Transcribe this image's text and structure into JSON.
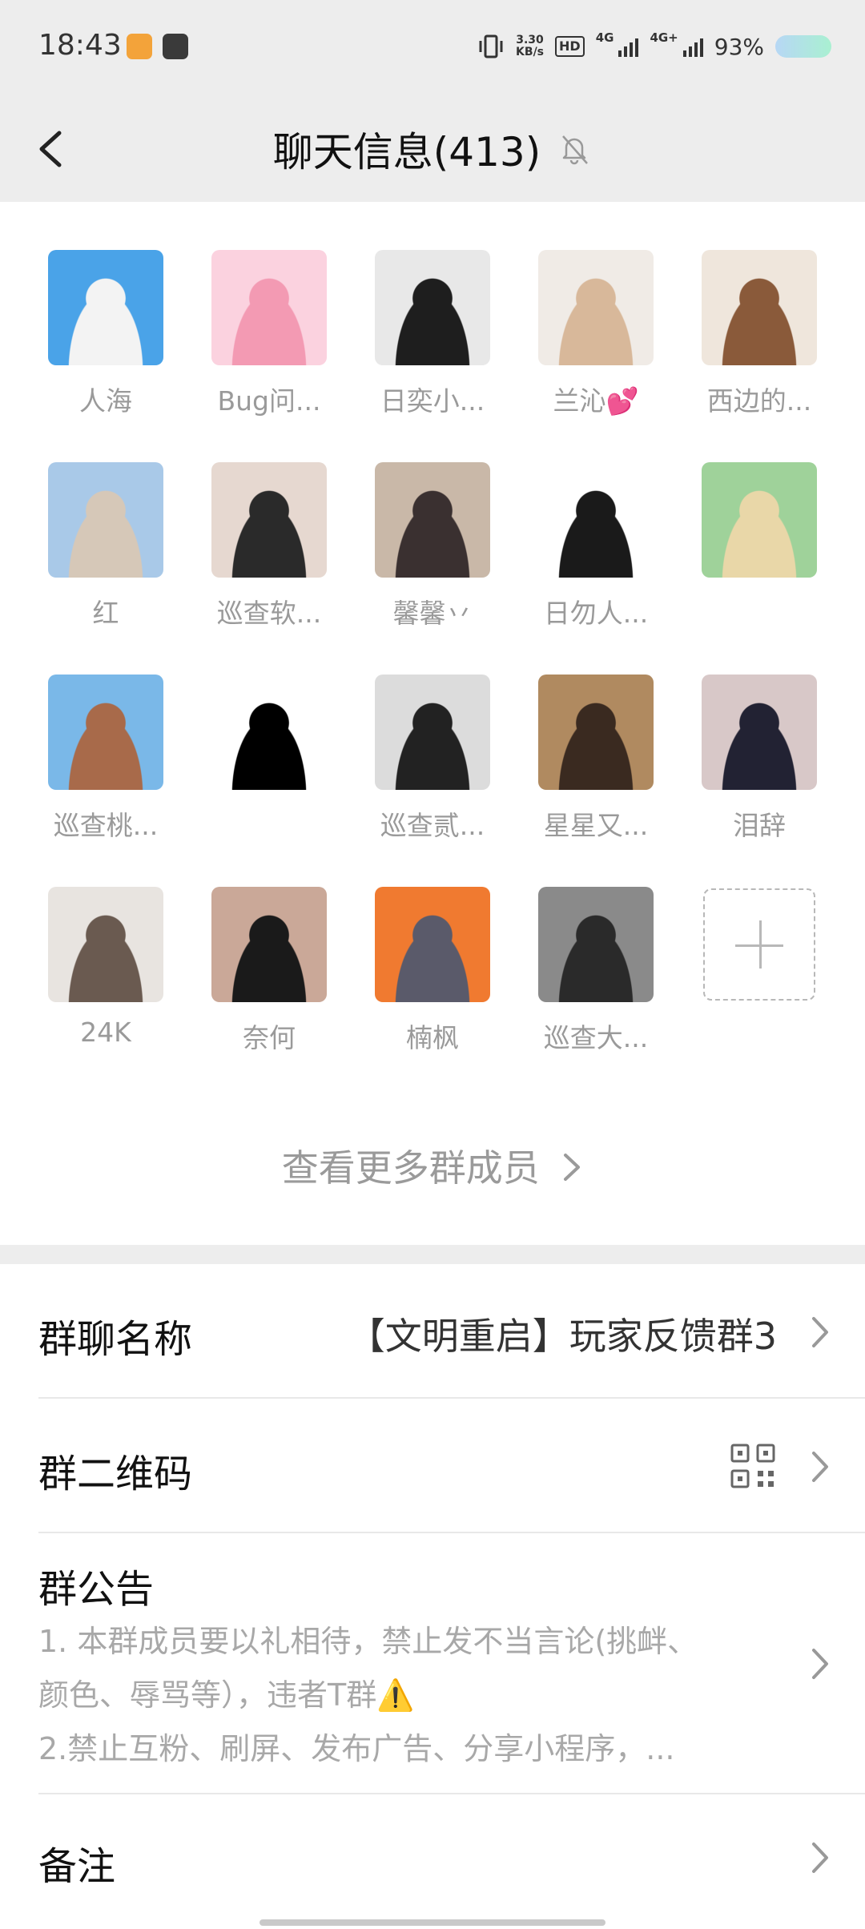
{
  "status_bar": {
    "time": "18:43",
    "net_speed_value": "3.30",
    "net_speed_unit": "KB/s",
    "hd_badge": "HD",
    "network_1": "4G",
    "network_2": "4G+",
    "battery": "93%"
  },
  "header": {
    "title": "聊天信息(413)",
    "back_icon": "chevron-left-icon",
    "mute_icon": "bell-off-icon"
  },
  "members": [
    {
      "name": "人海",
      "avatar_colors": [
        "#4aa3e8",
        "#f3f3f3"
      ]
    },
    {
      "name": "Bug问...",
      "avatar_colors": [
        "#fbd2df",
        "#f39ab3"
      ]
    },
    {
      "name": "日奕小...",
      "avatar_colors": [
        "#e8e8e8",
        "#1e1e1e"
      ]
    },
    {
      "name": "兰沁💕",
      "avatar_colors": [
        "#f0ebe6",
        "#d8b89a"
      ]
    },
    {
      "name": "西边的...",
      "avatar_colors": [
        "#efe6dc",
        "#8a5a3a"
      ]
    },
    {
      "name": "红",
      "avatar_colors": [
        "#a9c9e8",
        "#d6c8b8"
      ]
    },
    {
      "name": "巡查软...",
      "avatar_colors": [
        "#e6d8d0",
        "#2a2a2a"
      ]
    },
    {
      "name": "馨馨丷",
      "avatar_colors": [
        "#c9b8a8",
        "#3a3030"
      ]
    },
    {
      "name": "日勿人...",
      "avatar_colors": [
        "#ffffff",
        "#1a1a1a"
      ]
    },
    {
      "name": "",
      "avatar_colors": [
        "#9fd29a",
        "#e9d7a8"
      ]
    },
    {
      "name": "巡查桃...",
      "avatar_colors": [
        "#7ab8e8",
        "#a86a4a"
      ]
    },
    {
      "name": "",
      "avatar_colors": [
        "#ffffff",
        "#000000"
      ]
    },
    {
      "name": "巡查贰...",
      "avatar_colors": [
        "#dcdcdc",
        "#222222"
      ]
    },
    {
      "name": "星星又...",
      "avatar_colors": [
        "#b08a60",
        "#3a2a20"
      ]
    },
    {
      "name": "泪辞",
      "avatar_colors": [
        "#d8c8c8",
        "#223"
      ]
    },
    {
      "name": "24K",
      "avatar_colors": [
        "#e8e4e0",
        "#6a5a50"
      ]
    },
    {
      "name": "奈何",
      "avatar_colors": [
        "#caa898",
        "#1a1a1a"
      ]
    },
    {
      "name": "楠枫",
      "avatar_colors": [
        "#f07a30",
        "#5a5a6a"
      ]
    },
    {
      "name": "巡查大...",
      "avatar_colors": [
        "#8a8a8a",
        "#2a2a2a"
      ]
    }
  ],
  "add_member_icon": "plus-icon",
  "more_members_label": "查看更多群成员",
  "settings": {
    "group_name_label": "群聊名称",
    "group_name_value": "【文明重启】玩家反馈群3",
    "qr_label": "群二维码",
    "qr_icon": "qr-code-icon",
    "notice_label": "群公告",
    "notice_line1": "1. 本群成员要以礼相待，禁止发不当言论(挑衅、",
    "notice_line2": "颜色、辱骂等），违者T群⚠️",
    "notice_line3": "2.禁止互粉、刷屏、发布广告、分享小程序，...",
    "remark_label": "备注"
  }
}
